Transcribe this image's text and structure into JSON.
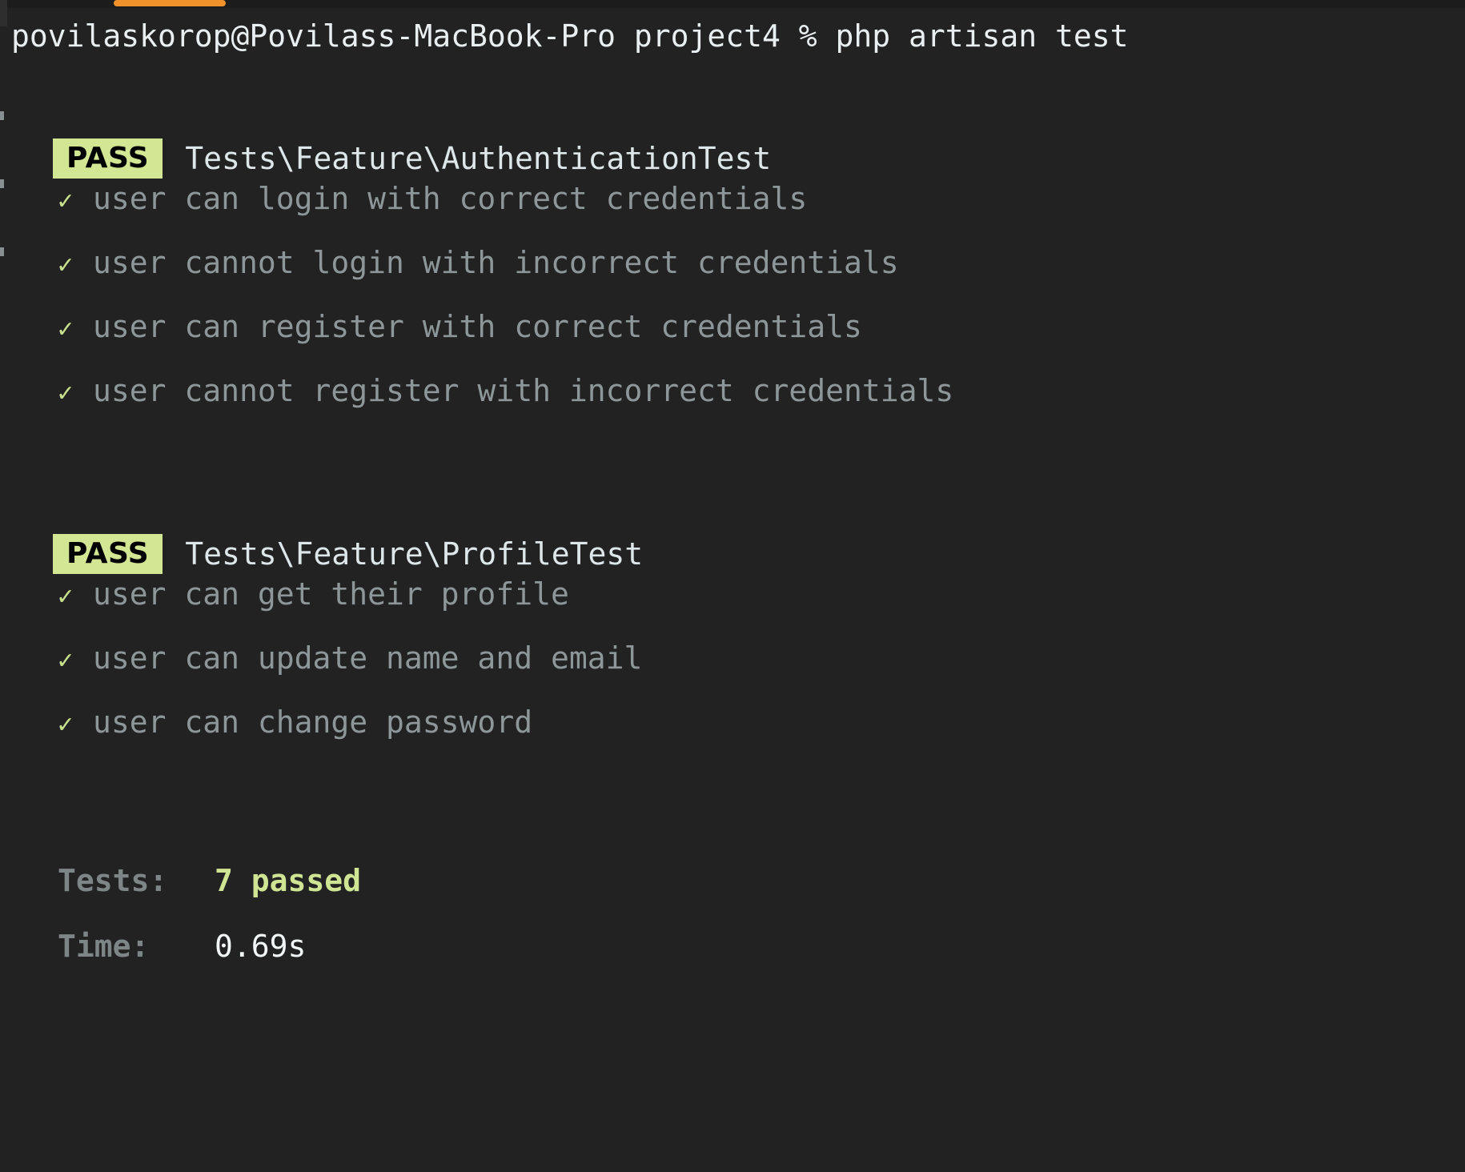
{
  "window": {
    "chrome": {
      "active_tab_indicator_color": "#f0922b",
      "tab_strip_color": "#1c1c1c"
    }
  },
  "theme": {
    "background": "#222222",
    "prompt_text": "#e9eff1",
    "badge_background": "#d3e693",
    "badge_text": "#000000",
    "suite_name": "#dde6e9",
    "check_icon": "#c9e18c",
    "test_name": "#8d9698",
    "summary_label": "#7e8587",
    "summary_accent": "#cfe594",
    "summary_plain": "#f2f6f7"
  },
  "terminal": {
    "prompt": {
      "user_host": "povilaskorop@Povilass-MacBook-Pro",
      "directory": "project4",
      "symbol": "%",
      "command": "php artisan test",
      "full_line": "povilaskorop@Povilass-MacBook-Pro project4 % php artisan test"
    },
    "suites": [
      {
        "status": "PASS",
        "name": "Tests\\Feature\\AuthenticationTest",
        "tests": [
          {
            "icon": "check-icon",
            "name": "user can login with correct credentials"
          },
          {
            "icon": "check-icon",
            "name": "user cannot login with incorrect credentials"
          },
          {
            "icon": "check-icon",
            "name": "user can register with correct credentials"
          },
          {
            "icon": "check-icon",
            "name": "user cannot register with incorrect credentials"
          }
        ]
      },
      {
        "status": "PASS",
        "name": "Tests\\Feature\\ProfileTest",
        "tests": [
          {
            "icon": "check-icon",
            "name": "user can get their profile"
          },
          {
            "icon": "check-icon",
            "name": "user can update name and email"
          },
          {
            "icon": "check-icon",
            "name": "user can change password"
          }
        ]
      }
    ],
    "summary": {
      "tests_label": "Tests:",
      "tests_value": "7 passed",
      "time_label": "Time:",
      "time_value": "0.69s"
    }
  }
}
